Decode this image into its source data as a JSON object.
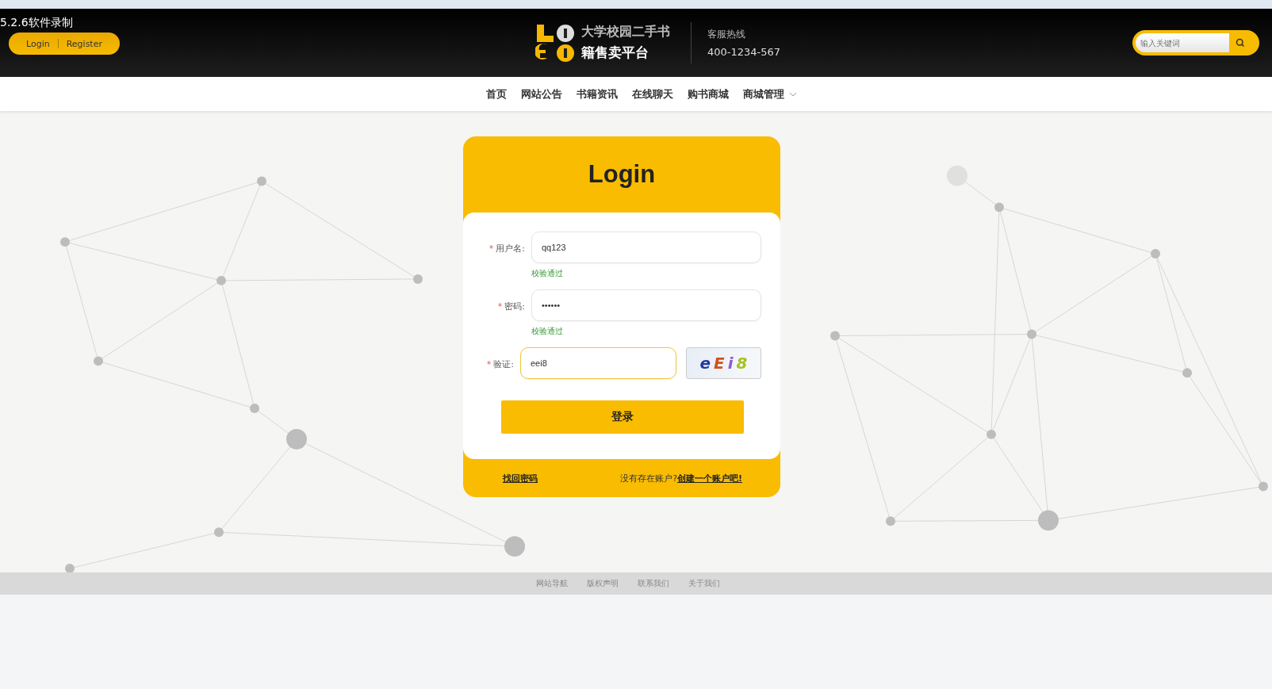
{
  "recorder_overlay": "5.2.6软件录制",
  "header": {
    "auth_buttons": [
      {
        "label": "Login"
      },
      {
        "label": "Register"
      }
    ],
    "logo": {
      "title_line_1": "大学校园二手书",
      "title_line_2": "籍售卖平台"
    },
    "hotline": {
      "label": "客服热线",
      "number": "400-1234-567"
    },
    "search": {
      "placeholder": "输入关键词"
    }
  },
  "nav": [
    {
      "label": "首页",
      "dropdown": false
    },
    {
      "label": "网站公告",
      "dropdown": false
    },
    {
      "label": "书籍资讯",
      "dropdown": false
    },
    {
      "label": "在线聊天",
      "dropdown": false
    },
    {
      "label": "购书商城",
      "dropdown": false
    },
    {
      "label": "商城管理",
      "dropdown": true
    }
  ],
  "login": {
    "title": "Login",
    "fields": [
      {
        "label": "用户名:",
        "required_mark": "*",
        "value": "qq123",
        "kind": "text",
        "focused": false,
        "hint": "校验通过"
      },
      {
        "label": "密码:",
        "required_mark": "*",
        "value": "••••••",
        "kind": "password",
        "focused": false,
        "hint": "校验通过"
      },
      {
        "label": "验证:",
        "required_mark": "*",
        "value": "eei8",
        "kind": "captcha",
        "focused": true,
        "captcha": "eEi8"
      }
    ],
    "submit": "登录",
    "forgot_link": "找回密码",
    "signup_prompt": "没有存在账户?",
    "signup_link": "创建一个账户吧!"
  },
  "footer_links": [
    "网站导航",
    "版权声明",
    "联系我们",
    "关于我们"
  ]
}
